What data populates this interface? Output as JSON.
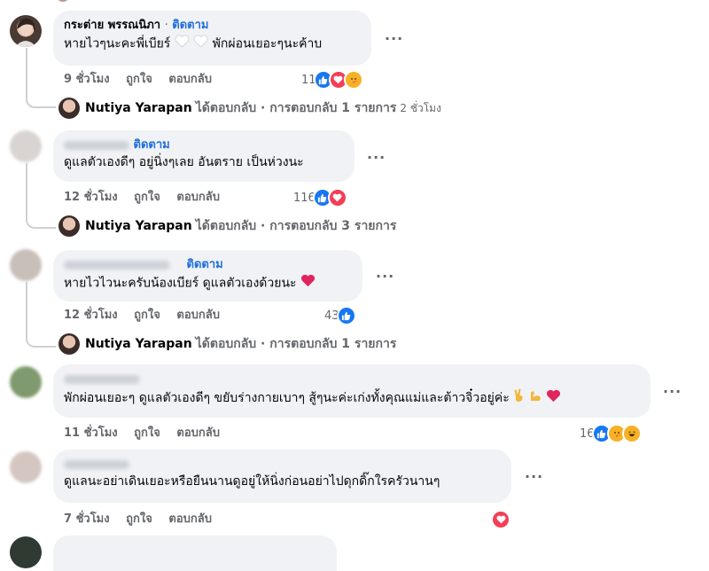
{
  "comments": [
    {
      "author": "กระต่าย พรรณนิภา",
      "separator": "·",
      "follow_label": "ติดตาม",
      "text": "หายไวๆนะคะพี่เบียร์",
      "text_suffix": "พักผ่อนเยอะๆนะค้าบ",
      "time": "9 ชั่วโมง",
      "like_label": "ถูกใจ",
      "reply_label": "ตอบกลับ",
      "reaction_count": "11",
      "reactions": [
        "like",
        "love",
        "care"
      ],
      "reply_summary": {
        "name": "Nutiya Yarapan",
        "action": "ได้ตอบกลับ · การตอบกลับ 1 รายการ",
        "time": "2 ชั่วโมง"
      }
    },
    {
      "author_hidden": true,
      "follow_label": "ติดตาม",
      "text": "ดูแลตัวเองดีๆ อยู่นิ่งๆเลย อันตราย เป็นห่วงนะ",
      "time": "12 ชั่วโมง",
      "like_label": "ถูกใจ",
      "reply_label": "ตอบกลับ",
      "reaction_count": "116",
      "reactions": [
        "like",
        "love"
      ],
      "reply_summary": {
        "name": "Nutiya Yarapan",
        "action": "ได้ตอบกลับ · การตอบกลับ 3 รายการ"
      }
    },
    {
      "author_hidden": true,
      "follow_label": "ติดตาม",
      "text": "หายไวไวนะครับน้องเบียร์ ดูแลตัวเองด้วยนะ",
      "text_emoji": "heart",
      "time": "12 ชั่วโมง",
      "like_label": "ถูกใจ",
      "reply_label": "ตอบกลับ",
      "reaction_count": "43",
      "reactions": [
        "like"
      ],
      "reply_summary": {
        "name": "Nutiya Yarapan",
        "action": "ได้ตอบกลับ · การตอบกลับ 1 รายการ"
      }
    },
    {
      "author_hidden": true,
      "text": "พักผ่อนเยอะๆ ดูแลตัวเองดีๆ ขยับร่างกายเบาๆ สู้ๆนะค่ะเก่งทั้งคุณแม่และต้าวจิ๋วอยู่ค่ะ",
      "text_emojis": [
        "victory-hand",
        "muscle",
        "heart"
      ],
      "time": "11 ชั่วโมง",
      "like_label": "ถูกใจ",
      "reply_label": "ตอบกลับ",
      "reaction_count": "16",
      "reactions": [
        "like",
        "care",
        "haha"
      ]
    },
    {
      "author_hidden": true,
      "text": "ดูแลนะอย่าเดินเยอะหรือยืนนานดูอยู่ให้นิ่งก่อนอย่าไปดุกดิ๊กใรครัวนานๆ",
      "time": "7 ชั่วโมง",
      "like_label": "ถูกใจ",
      "reply_label": "ตอบกลับ",
      "reactions": [
        "love"
      ]
    }
  ],
  "colors": {
    "link_blue": "#216fdb",
    "like_blue": "#1877f2",
    "love_red": "#f33e58",
    "care_yellow": "#f7b125",
    "bubble_gray": "#f0f2f5",
    "meta_gray": "#65676b"
  }
}
